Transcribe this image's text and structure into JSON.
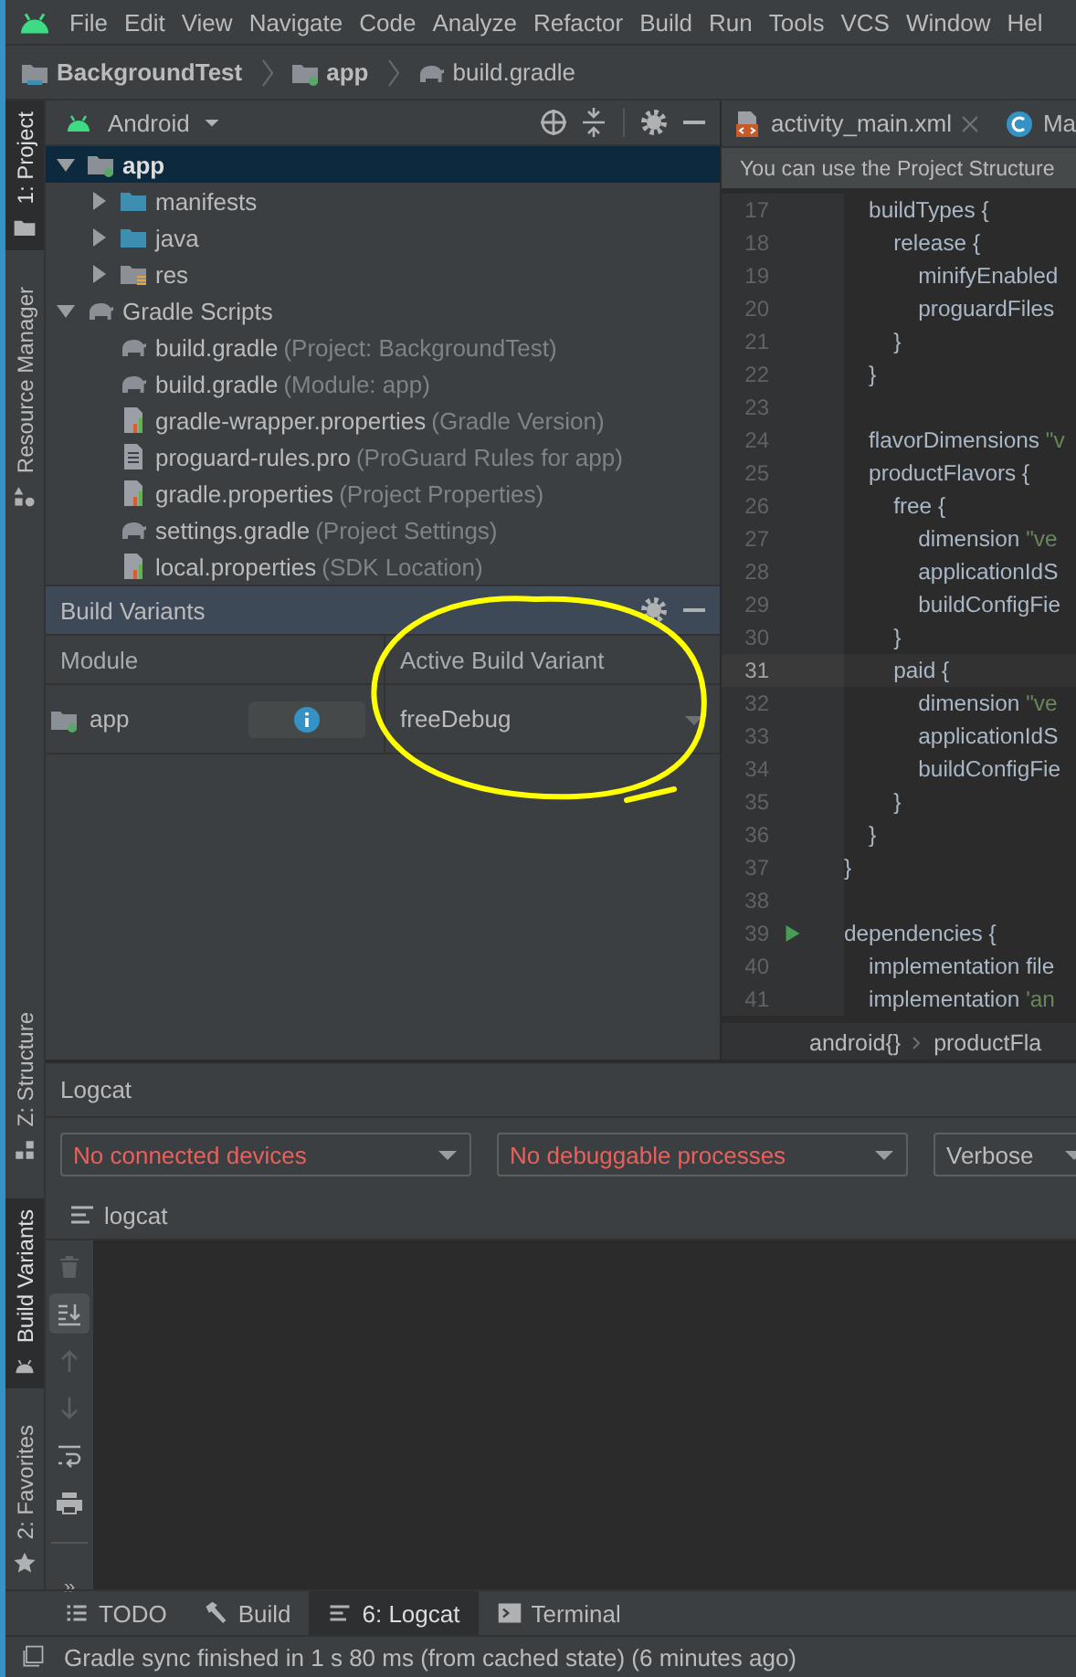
{
  "menu": [
    "File",
    "Edit",
    "View",
    "Navigate",
    "Code",
    "Analyze",
    "Refactor",
    "Build",
    "Run",
    "Tools",
    "VCS",
    "Window",
    "Hel"
  ],
  "breadcrumbs": [
    {
      "label": "BackgroundTest",
      "kind": "project"
    },
    {
      "label": "app",
      "kind": "module"
    },
    {
      "label": "build.gradle",
      "kind": "gradle"
    }
  ],
  "tool_stripe": {
    "top": [
      {
        "label": "1: Project",
        "kind": "folder",
        "selected": true
      },
      {
        "label": "Resource Manager",
        "kind": "shapes",
        "selected": false
      }
    ],
    "bottom": [
      {
        "label": "Z: Structure",
        "kind": "structure",
        "selected": false
      },
      {
        "label": "Build Variants",
        "kind": "android",
        "selected": true
      },
      {
        "label": "2: Favorites",
        "kind": "star",
        "selected": false
      }
    ]
  },
  "project": {
    "view": "Android",
    "tree": [
      {
        "label": "app",
        "kind": "module",
        "expanded": true,
        "selected": true,
        "children": [
          {
            "label": "manifests",
            "kind": "folder",
            "expanded": false,
            "selected": false
          },
          {
            "label": "java",
            "kind": "folder",
            "expanded": false,
            "selected": false
          },
          {
            "label": "res",
            "kind": "res",
            "expanded": false,
            "selected": false
          }
        ]
      },
      {
        "label": "Gradle Scripts",
        "kind": "gradle",
        "expanded": true,
        "selected": false,
        "children": [
          {
            "label": "build.gradle",
            "note": "(Project: BackgroundTest)",
            "kind": "gradle",
            "selected": false
          },
          {
            "label": "build.gradle",
            "note": "(Module: app)",
            "kind": "gradle",
            "selected": false
          },
          {
            "label": "gradle-wrapper.properties",
            "note": "(Gradle Version)",
            "kind": "properties",
            "selected": false
          },
          {
            "label": "proguard-rules.pro",
            "note": "(ProGuard Rules for app)",
            "kind": "text",
            "selected": false
          },
          {
            "label": "gradle.properties",
            "note": "(Project Properties)",
            "kind": "properties",
            "selected": false
          },
          {
            "label": "settings.gradle",
            "note": "(Project Settings)",
            "kind": "gradle",
            "selected": false
          },
          {
            "label": "local.properties",
            "note": "(SDK Location)",
            "kind": "properties",
            "selected": false
          }
        ]
      }
    ]
  },
  "build_variants": {
    "title": "Build Variants",
    "columns": [
      "Module",
      "Active Build Variant"
    ],
    "rows": [
      {
        "module": "app",
        "variant": "freeDebug"
      }
    ]
  },
  "editor": {
    "tabs": [
      {
        "label": "activity_main.xml",
        "kind": "xml",
        "selected": false,
        "closable": true
      },
      {
        "label": "Ma",
        "kind": "class",
        "selected": false
      }
    ],
    "notice": "You can use the Project Structure",
    "lines": [
      {
        "number": "17",
        "code": "    buildTypes {",
        "current": false,
        "run": false
      },
      {
        "number": "18",
        "code": "        release {",
        "current": false,
        "run": false
      },
      {
        "number": "19",
        "code": "            minifyEnabled",
        "current": false,
        "run": false
      },
      {
        "number": "20",
        "code": "            proguardFiles",
        "current": false,
        "run": false
      },
      {
        "number": "21",
        "code": "        }",
        "current": false,
        "run": false
      },
      {
        "number": "22",
        "code": "    }",
        "current": false,
        "run": false
      },
      {
        "number": "23",
        "current": false,
        "run": false
      },
      {
        "number": "24",
        "code": "    flavorDimensions ",
        "string": "\"v",
        "current": false,
        "run": false
      },
      {
        "number": "25",
        "code": "    productFlavors {",
        "current": false,
        "run": false
      },
      {
        "number": "26",
        "code": "        free {",
        "current": false,
        "run": false
      },
      {
        "number": "27",
        "code": "            dimension ",
        "string": "\"ve",
        "current": false,
        "run": false
      },
      {
        "number": "28",
        "code": "            applicationIdS",
        "current": false,
        "run": false
      },
      {
        "number": "29",
        "code": "            buildConfigFie",
        "current": false,
        "run": false
      },
      {
        "number": "30",
        "code": "        }",
        "current": false,
        "run": false
      },
      {
        "number": "31",
        "code": "        paid {",
        "current": true,
        "run": false
      },
      {
        "number": "32",
        "code": "            dimension ",
        "string": "\"ve",
        "current": false,
        "run": false
      },
      {
        "number": "33",
        "code": "            applicationIdS",
        "current": false,
        "run": false
      },
      {
        "number": "34",
        "code": "            buildConfigFie",
        "current": false,
        "run": false
      },
      {
        "number": "35",
        "code": "        }",
        "current": false,
        "run": false
      },
      {
        "number": "36",
        "code": "    }",
        "current": false,
        "run": false
      },
      {
        "number": "37",
        "code": "}",
        "current": false,
        "run": false
      },
      {
        "number": "38",
        "current": false,
        "run": false
      },
      {
        "number": "39",
        "code": "dependencies {",
        "current": false,
        "run": true
      },
      {
        "number": "40",
        "code": "    implementation file",
        "current": false,
        "run": false
      },
      {
        "number": "41",
        "code": "    implementation ",
        "string": "'an",
        "current": false,
        "run": false
      }
    ],
    "breadcrumb": [
      "android{}",
      "productFla"
    ]
  },
  "logcat": {
    "title": "Logcat",
    "filters": [
      {
        "label": "No connected devices",
        "error": true
      },
      {
        "label": "No debuggable processes",
        "error": true
      },
      {
        "label": "Verbose",
        "error": false
      }
    ],
    "tab": "logcat",
    "tools": [
      {
        "kind": "trash",
        "disabled": true,
        "selected": false
      },
      {
        "kind": "scroll-end",
        "disabled": false,
        "selected": true
      },
      {
        "kind": "up",
        "disabled": true,
        "selected": false
      },
      {
        "kind": "down",
        "disabled": true,
        "selected": false
      },
      {
        "kind": "wrap",
        "disabled": false,
        "selected": false
      },
      {
        "kind": "print",
        "disabled": false,
        "selected": false
      }
    ],
    "more": "»"
  },
  "bottom_tabs": [
    {
      "label": "TODO",
      "kind": "list",
      "selected": false
    },
    {
      "label": "Build",
      "kind": "hammer",
      "selected": false
    },
    {
      "label": "6: Logcat",
      "kind": "lines",
      "selected": true
    },
    {
      "label": "Terminal",
      "kind": "terminal",
      "selected": false
    }
  ],
  "status": "Gradle sync finished in 1 s 80 ms (from cached state) (6 minutes ago)"
}
